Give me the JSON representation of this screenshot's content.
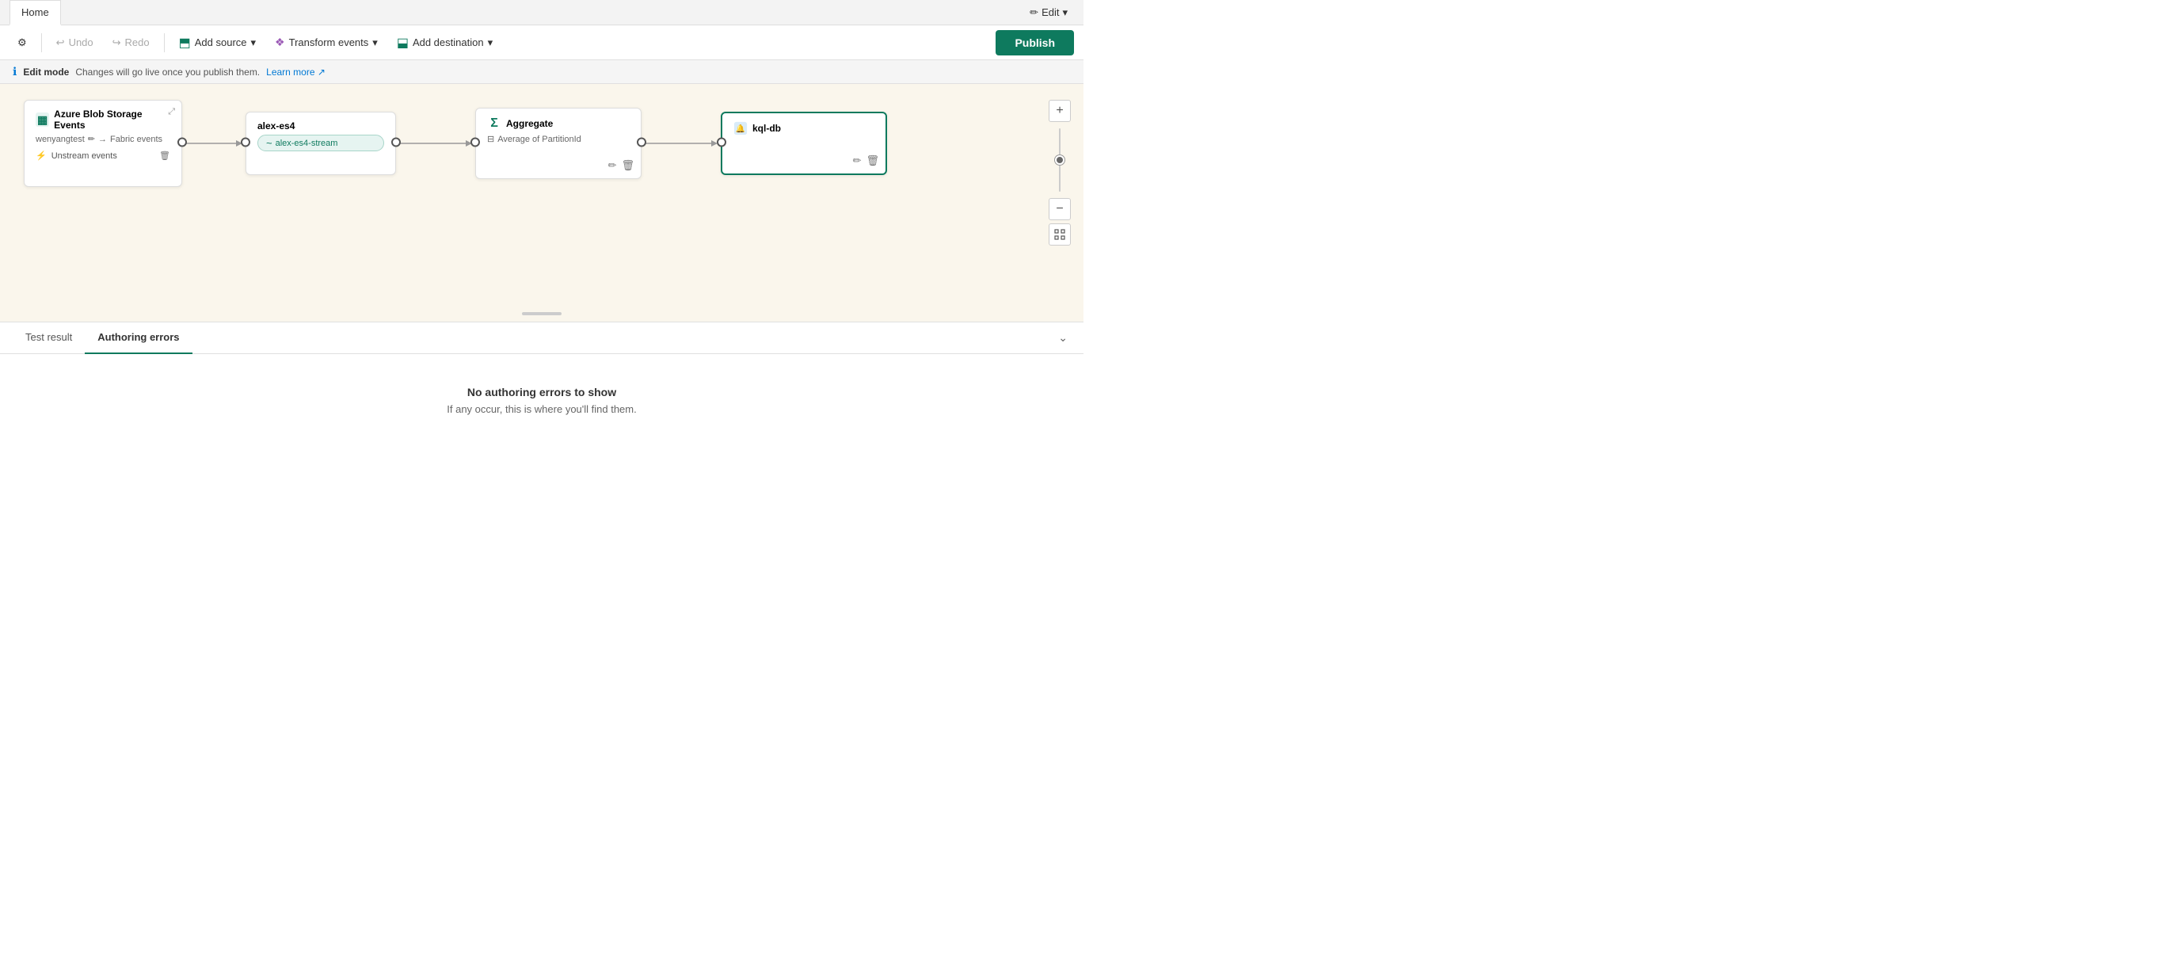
{
  "tab": {
    "home_label": "Home",
    "edit_label": "Edit",
    "edit_icon": "✏"
  },
  "toolbar": {
    "settings_icon": "⚙",
    "undo_label": "Undo",
    "undo_icon": "↩",
    "redo_label": "Redo",
    "redo_icon": "↪",
    "add_source_label": "Add source",
    "add_source_icon": "⬒",
    "add_source_chevron": "▾",
    "transform_label": "Transform events",
    "transform_icon": "✦",
    "transform_chevron": "▾",
    "add_destination_label": "Add destination",
    "add_destination_icon": "⬓",
    "add_destination_chevron": "▾",
    "publish_label": "Publish"
  },
  "edit_banner": {
    "info_text": "Edit mode",
    "message": "Changes will go live once you publish them.",
    "learn_more": "Learn more",
    "external_icon": "↗"
  },
  "nodes": {
    "source": {
      "title": "Azure Blob Storage Events",
      "icon": "▦",
      "sub_user": "wenyangtest",
      "sub_arrow": "→",
      "sub_dest": "Fabric events",
      "unstream_label": "Unstream events",
      "unstream_icon": "⚡",
      "expand_icon": "⤢"
    },
    "stream": {
      "title": "alex-es4",
      "pill_label": "alex-es4-stream",
      "pill_icon": "~"
    },
    "transform": {
      "title": "Aggregate",
      "sub": "Average of PartitionId",
      "sigma_icon": "Σ",
      "table_icon": "⊟"
    },
    "destination": {
      "title": "kql-db",
      "icon": "🔔",
      "selected": true
    }
  },
  "bottom_panel": {
    "tab1_label": "Test result",
    "tab2_label": "Authoring errors",
    "no_errors_title": "No authoring errors to show",
    "no_errors_sub": "If any occur, this is where you'll find them.",
    "chevron_icon": "⌄"
  }
}
